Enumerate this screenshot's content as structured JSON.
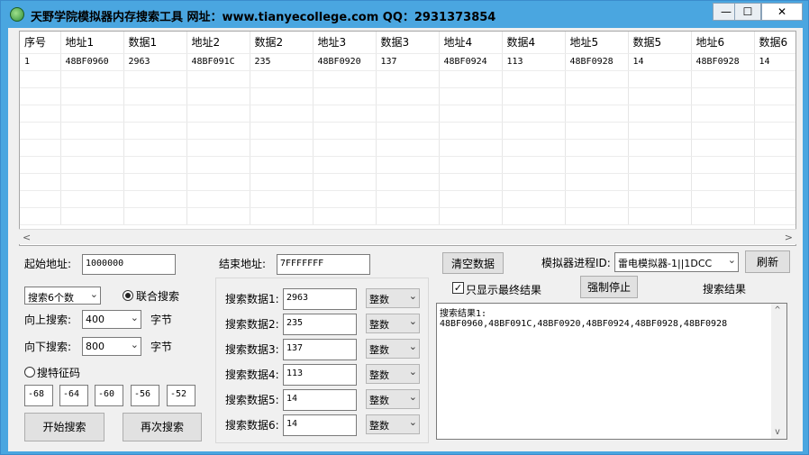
{
  "window": {
    "title": "天野学院模拟器内存搜索工具    网址：www.tianyecollege.com     QQ：2931373854",
    "minimize": "—",
    "maximize": "☐",
    "close": "✕"
  },
  "table": {
    "columns": [
      "序号",
      "地址1",
      "数据1",
      "地址2",
      "数据2",
      "地址3",
      "数据3",
      "地址4",
      "数据4",
      "地址5",
      "数据5",
      "地址6",
      "数据6"
    ],
    "rows": [
      [
        "1",
        "48BF0960",
        "2963",
        "48BF091C",
        "235",
        "48BF0920",
        "137",
        "48BF0924",
        "113",
        "48BF0928",
        "14",
        "48BF0928",
        "14"
      ]
    ]
  },
  "form": {
    "start_label": "起始地址:",
    "start_value": "1000000",
    "end_label": "结束地址:",
    "end_value": "7FFFFFFF",
    "clear_button": "清空数据",
    "process_label": "模拟器进程ID:",
    "process_value": "雷电模拟器-1||1DCC",
    "refresh_button": "刷新",
    "search_count": "搜索6个数",
    "combined_label": "联合搜索",
    "up_label": "向上搜索:",
    "up_value": "400",
    "down_label": "向下搜索:",
    "down_value": "800",
    "bytes_unit": "字节",
    "feature_label": "搜特征码",
    "offsets": [
      "-68",
      "-64",
      "-60",
      "-56",
      "-52"
    ],
    "start_button": "开始搜索",
    "again_button": "再次搜索",
    "final_only_label": "只显示最终结果",
    "force_stop_button": "强制停止",
    "result_title": "搜索结果"
  },
  "search_data": [
    {
      "label": "搜索数据1:",
      "value": "2963",
      "type": "整数"
    },
    {
      "label": "搜索数据2:",
      "value": "235",
      "type": "整数"
    },
    {
      "label": "搜索数据3:",
      "value": "137",
      "type": "整数"
    },
    {
      "label": "搜索数据4:",
      "value": "113",
      "type": "整数"
    },
    {
      "label": "搜索数据5:",
      "value": "14",
      "type": "整数"
    },
    {
      "label": "搜索数据6:",
      "value": "14",
      "type": "整数"
    }
  ],
  "result_text": {
    "line1": "搜索结果1:",
    "line2": "48BF0960,48BF091C,48BF0920,48BF0924,48BF0928,48BF0928"
  }
}
